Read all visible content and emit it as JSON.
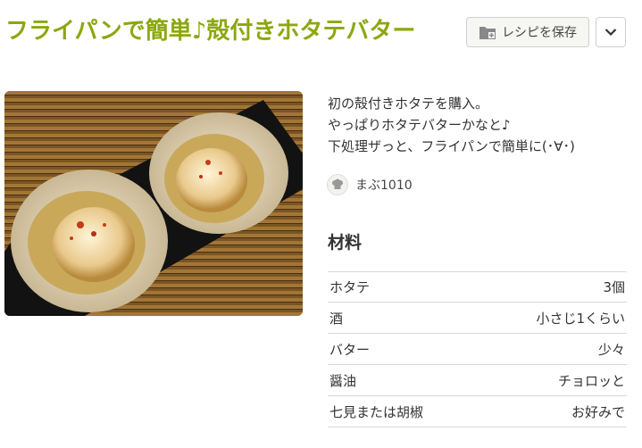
{
  "recipe": {
    "title": "フライパンで簡単♪殻付きホタテバター",
    "save_label": "レシピを保存",
    "description": [
      "初の殻付きホタテを購入。",
      "やっぱりホタテバターかなと♪",
      "下処理ザっと、フライパンで簡単に(･∀･)"
    ],
    "author": "まぶ1010",
    "ingredients_title": "材料",
    "ingredients": [
      {
        "name": "ホタテ",
        "qty": "3個"
      },
      {
        "name": "酒",
        "qty": "小さじ1くらい"
      },
      {
        "name": "バター",
        "qty": "少々"
      },
      {
        "name": "醤油",
        "qty": "チョロッと"
      },
      {
        "name": "七見または胡椒",
        "qty": "お好みで"
      }
    ]
  },
  "colors": {
    "title": "#8ba80c",
    "border": "#d8d8d8"
  },
  "icons": {
    "save": "folder-plus-icon",
    "menu": "chevron-down-icon",
    "avatar": "chef-hat-icon"
  }
}
